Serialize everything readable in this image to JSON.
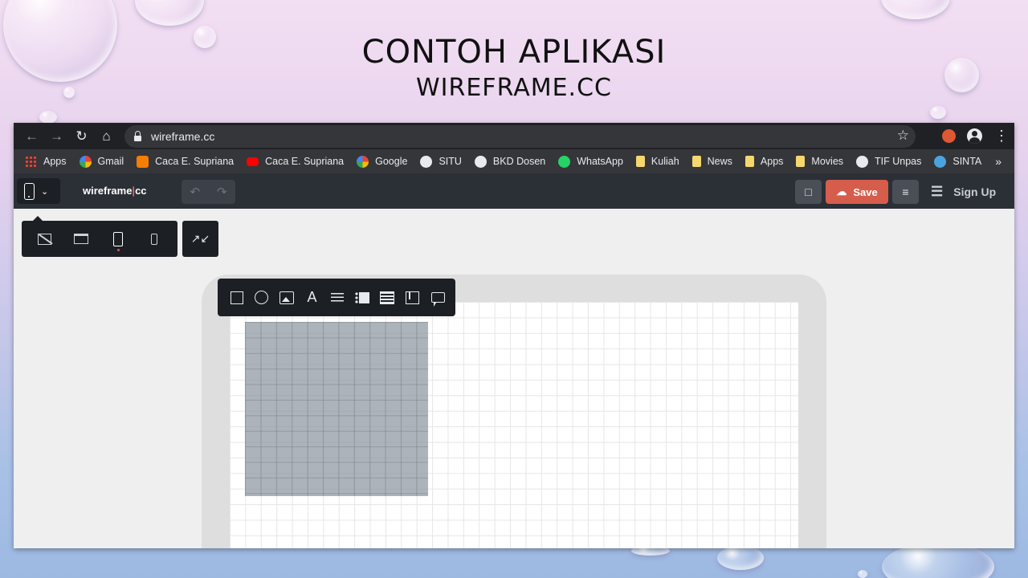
{
  "slide": {
    "title_line1": "CONTOH APLIKASI",
    "title_line2": "WIREFRAME.CC"
  },
  "browser": {
    "url": "wireframe.cc",
    "bookmarks": [
      {
        "label": "Apps",
        "icon": "apps-grid-icon"
      },
      {
        "label": "Gmail",
        "icon": "google-icon"
      },
      {
        "label": "Caca E. Supriana",
        "icon": "blogger-icon"
      },
      {
        "label": "Caca E. Supriana",
        "icon": "youtube-icon"
      },
      {
        "label": "Google",
        "icon": "google-icon"
      },
      {
        "label": "SITU",
        "icon": "globe-icon"
      },
      {
        "label": "BKD Dosen",
        "icon": "globe-icon"
      },
      {
        "label": "WhatsApp",
        "icon": "whatsapp-icon"
      },
      {
        "label": "Kuliah",
        "icon": "folder-icon"
      },
      {
        "label": "News",
        "icon": "folder-icon"
      },
      {
        "label": "Apps",
        "icon": "folder-icon"
      },
      {
        "label": "Movies",
        "icon": "folder-icon"
      },
      {
        "label": "TIF Unpas",
        "icon": "globe-icon"
      },
      {
        "label": "SINTA",
        "icon": "sinta-icon"
      }
    ],
    "more": "»"
  },
  "app": {
    "logo_left": "wireframe",
    "logo_sep": "|",
    "logo_right": "cc",
    "save_label": "Save",
    "signup_label": "Sign Up",
    "accent": "#d65d4b"
  }
}
